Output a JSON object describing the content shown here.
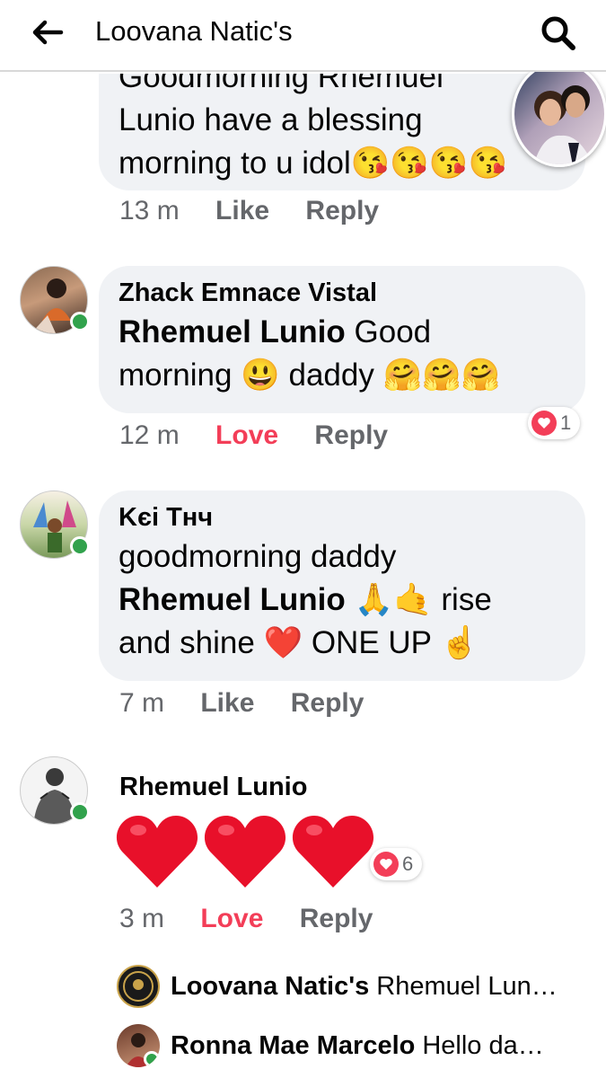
{
  "header": {
    "title": "Loovana Natic's",
    "back_icon": "arrow-left-icon",
    "search_icon": "search-icon"
  },
  "colors": {
    "love": "#f33e58",
    "online": "#31a24c",
    "bubble": "#f0f2f5",
    "meta": "#65676b"
  },
  "comments": [
    {
      "partial_text_top": "Goodmorning Rhemuel",
      "line1": "Lunio have a blessing",
      "line2": "morning to u idol",
      "emoji": "😘😘😘😘",
      "time": "13 m",
      "like": "Like",
      "reply": "Reply"
    },
    {
      "author": "Zhack Emnace Vistal",
      "mention": "Rhemuel Lunio",
      "text_after": " Good",
      "line2": "morning 😃 daddy 🤗🤗🤗",
      "time": "12 m",
      "like": "Love",
      "reply": "Reply",
      "reaction_count": "1"
    },
    {
      "author": "Κєі Тнч",
      "line1": "goodmorning daddy",
      "mention": "Rhemuel Lunio",
      "text_after": " 🙏🤙 rise",
      "line3": "and shine ❤️ ONE UP ☝️",
      "time": "7 m",
      "like": "Like",
      "reply": "Reply"
    },
    {
      "author": "Rhemuel Lunio",
      "time": "3 m",
      "like": "Love",
      "reply": "Reply",
      "reaction_count": "6"
    }
  ],
  "replies": [
    {
      "name": "Loovana Natic's",
      "text": "Rhemuel Lun…"
    },
    {
      "name": "Ronna Mae Marcelo",
      "text": "Hello da…"
    }
  ]
}
